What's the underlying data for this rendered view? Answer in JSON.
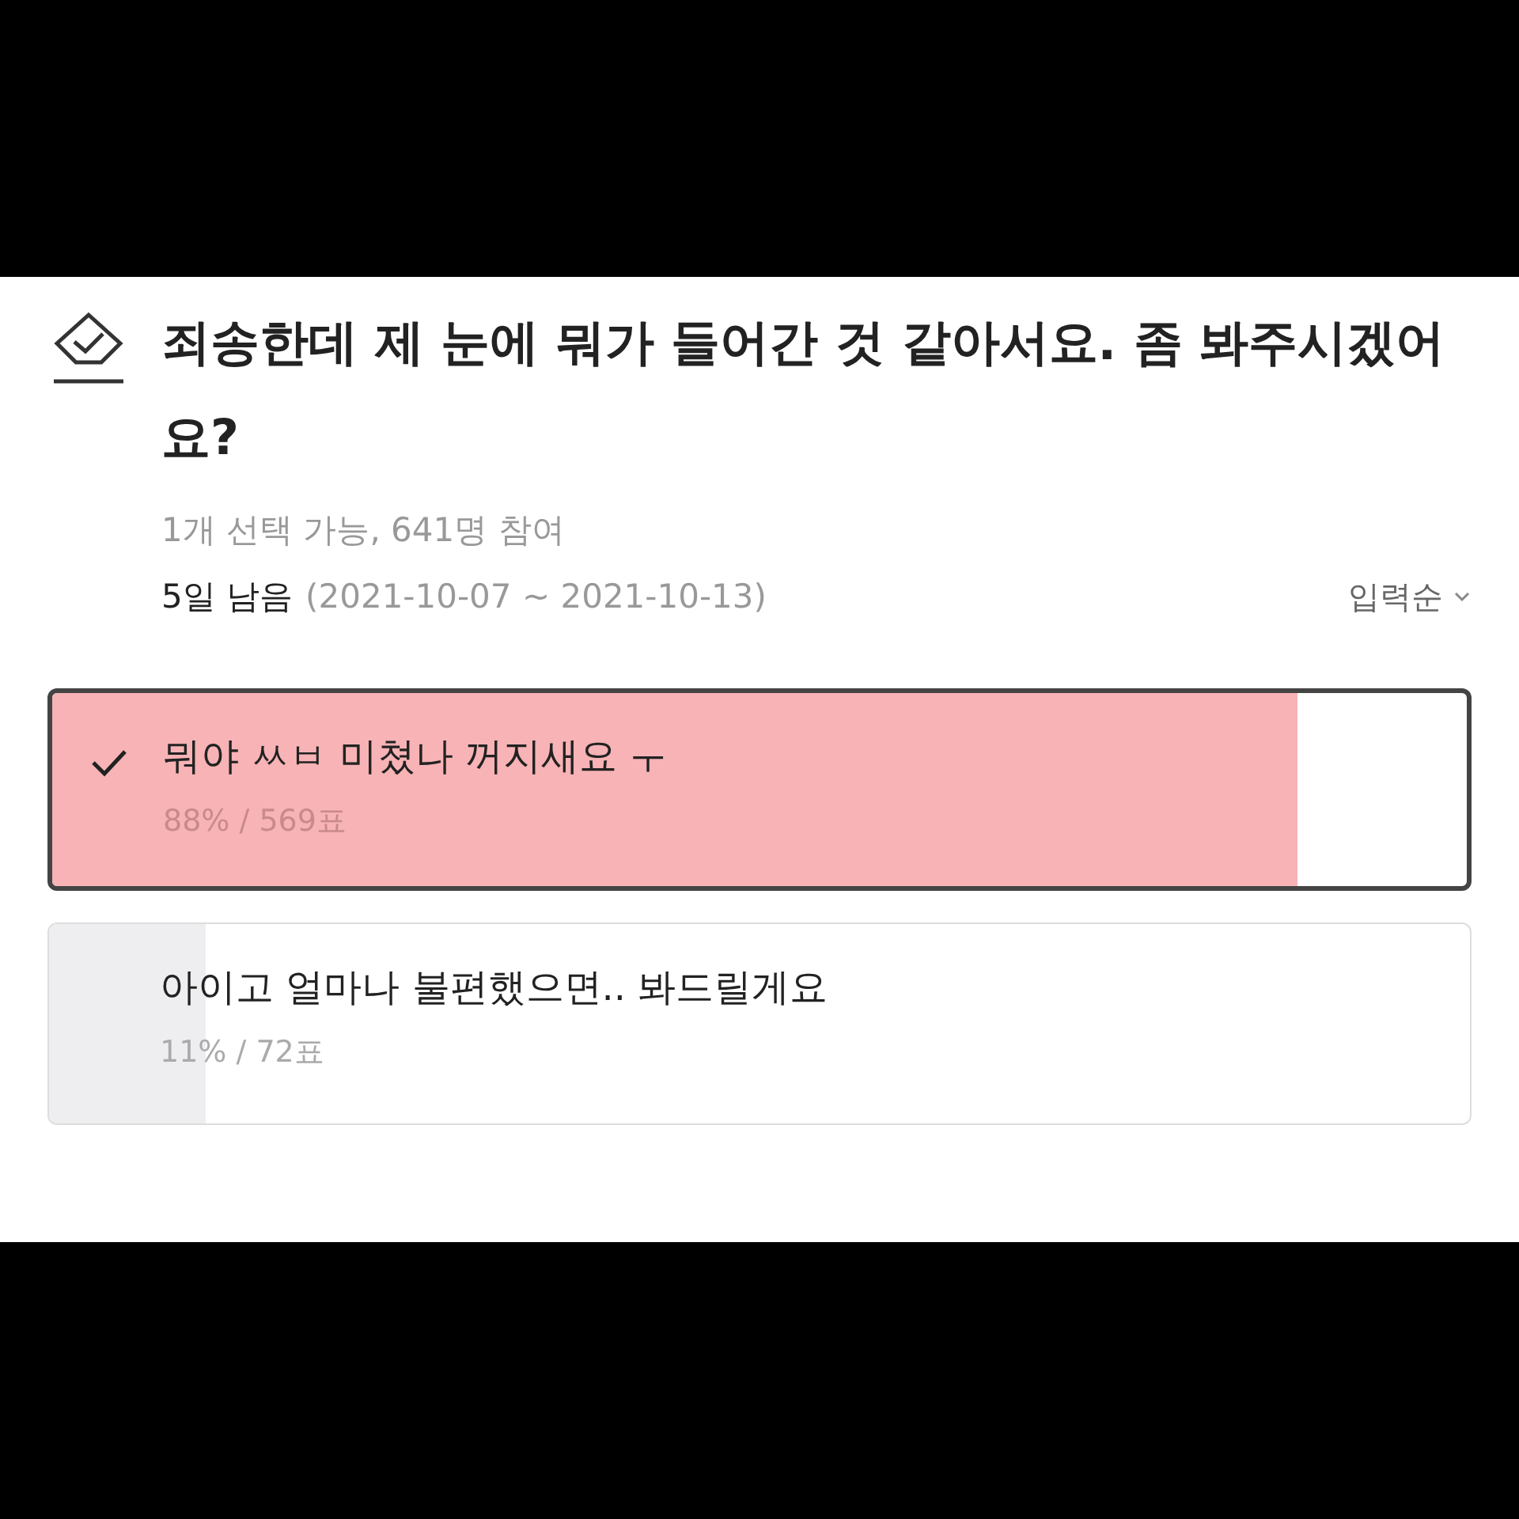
{
  "poll": {
    "title": "죄송한데 제 눈에 뭐가 들어간 것 같아서요. 좀 봐주시겠어요?",
    "info": "1개 선택 가능, 641명 참여",
    "remaining": "5일 남음",
    "period": "(2021-10-07 ~ 2021-10-13)",
    "sort": "입력순",
    "options": [
      {
        "label": "뭐야 ㅆㅂ 미쳤나 꺼지새요 ㅜ",
        "result": "88% / 569표",
        "level": 0.88,
        "selected": true
      },
      {
        "label": "아이고 얼마나 불편했으면.. 봐드릴게요",
        "result": "11% / 72표",
        "level": 0.11,
        "selected": false
      }
    ]
  }
}
